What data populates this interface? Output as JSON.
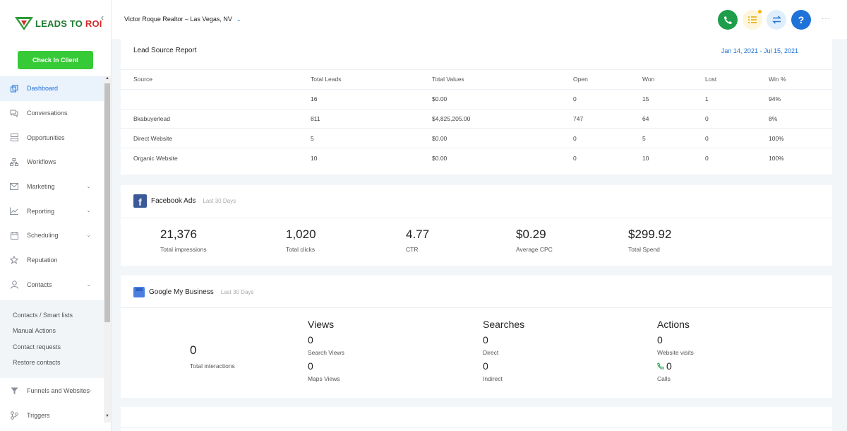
{
  "brand": {
    "logo_text_a": "LEADS TO ",
    "logo_text_b": "ROI"
  },
  "sidebar": {
    "checkin_label": "Check In Client",
    "items": [
      {
        "label": "Dashboard",
        "icon": "dashboard-icon"
      },
      {
        "label": "Conversations",
        "icon": "chat-icon"
      },
      {
        "label": "Opportunities",
        "icon": "opportunities-icon"
      },
      {
        "label": "Workflows",
        "icon": "workflow-icon"
      },
      {
        "label": "Marketing",
        "icon": "mail-icon"
      },
      {
        "label": "Reporting",
        "icon": "chart-icon"
      },
      {
        "label": "Scheduling",
        "icon": "calendar-icon"
      },
      {
        "label": "Reputation",
        "icon": "star-icon"
      },
      {
        "label": "Contacts",
        "icon": "person-icon"
      }
    ],
    "sub_items": [
      "Contacts / Smart lists",
      "Manual Actions",
      "Contact requests",
      "Restore contacts"
    ],
    "items2": [
      {
        "label": "Funnels and Websites",
        "icon": "filter-icon"
      },
      {
        "label": "Triggers",
        "icon": "trigger-icon"
      }
    ]
  },
  "topbar": {
    "account_name": "Victor Roque Realtor – Las Vegas, NV",
    "help_label": "?",
    "more_label": "···"
  },
  "lead_report": {
    "title": "Lead Source Report",
    "date_range": "Jan 14, 2021 - Jul 15, 2021",
    "columns": [
      "Source",
      "Total Leads",
      "Total Values",
      "Open",
      "Won",
      "Lost",
      "Win %"
    ],
    "rows": [
      [
        "",
        "16",
        "$0.00",
        "0",
        "15",
        "1",
        "94%"
      ],
      [
        "Bkabuyerlead",
        "811",
        "$4,825,205.00",
        "747",
        "64",
        "0",
        "8%"
      ],
      [
        "Direct Website",
        "5",
        "$0.00",
        "0",
        "5",
        "0",
        "100%"
      ],
      [
        "Organic Website",
        "10",
        "$0.00",
        "0",
        "10",
        "0",
        "100%"
      ]
    ]
  },
  "facebook": {
    "title": "Facebook Ads",
    "period": "Last 30 Days",
    "stats": [
      {
        "value": "21,376",
        "label": "Total impressions"
      },
      {
        "value": "1,020",
        "label": "Total clicks"
      },
      {
        "value": "4.77",
        "label": "CTR"
      },
      {
        "value": "$0.29",
        "label": "Average CPC"
      },
      {
        "value": "$299.92",
        "label": "Total Spend"
      }
    ]
  },
  "gmb": {
    "title": "Google My Business",
    "period": "Last 30 Days",
    "total": {
      "value": "0",
      "label": "Total interactions"
    },
    "views": {
      "heading": "Views",
      "a_value": "0",
      "a_label": "Search Views",
      "b_value": "0",
      "b_label": "Maps Views"
    },
    "searches": {
      "heading": "Searches",
      "a_value": "0",
      "a_label": "Direct",
      "b_value": "0",
      "b_label": "Indirect"
    },
    "actions": {
      "heading": "Actions",
      "a_value": "0",
      "a_label": "Website visits",
      "b_value": "0",
      "b_label": "Calls"
    }
  }
}
